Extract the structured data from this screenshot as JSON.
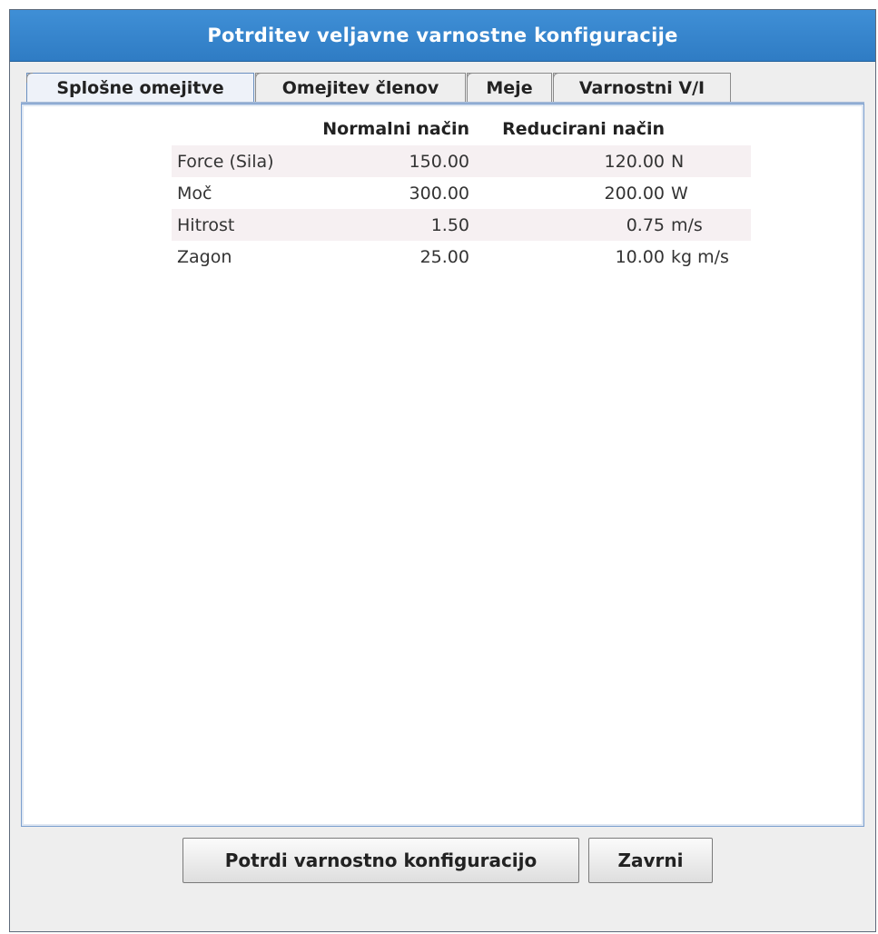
{
  "dialog": {
    "title": "Potrditev veljavne varnostne konfiguracije"
  },
  "tabs": [
    {
      "label": "Splošne omejitve",
      "selected": true
    },
    {
      "label": "Omejitev členov",
      "selected": false
    },
    {
      "label": "Meje",
      "selected": false
    },
    {
      "label": "Varnostni V/I",
      "selected": false
    }
  ],
  "limits_table": {
    "headers": {
      "name": "",
      "normal": "Normalni način",
      "reduced": "Reducirani način",
      "unit": ""
    },
    "rows": [
      {
        "name": "Force (Sila)",
        "normal": "150.00",
        "reduced": "120.00",
        "unit": "N"
      },
      {
        "name": "Moč",
        "normal": "300.00",
        "reduced": "200.00",
        "unit": "W"
      },
      {
        "name": "Hitrost",
        "normal": "1.50",
        "reduced": "0.75",
        "unit": "m/s"
      },
      {
        "name": "Zagon",
        "normal": "25.00",
        "reduced": "10.00",
        "unit": "kg m/s"
      }
    ]
  },
  "buttons": {
    "confirm_label": "Potrdi varnostno konfiguracijo",
    "close_label": "Zavrni"
  },
  "colors": {
    "titlebar": "#3584d0",
    "row_shade": "#f6f0f2",
    "content_border": "#7b9fcf"
  }
}
